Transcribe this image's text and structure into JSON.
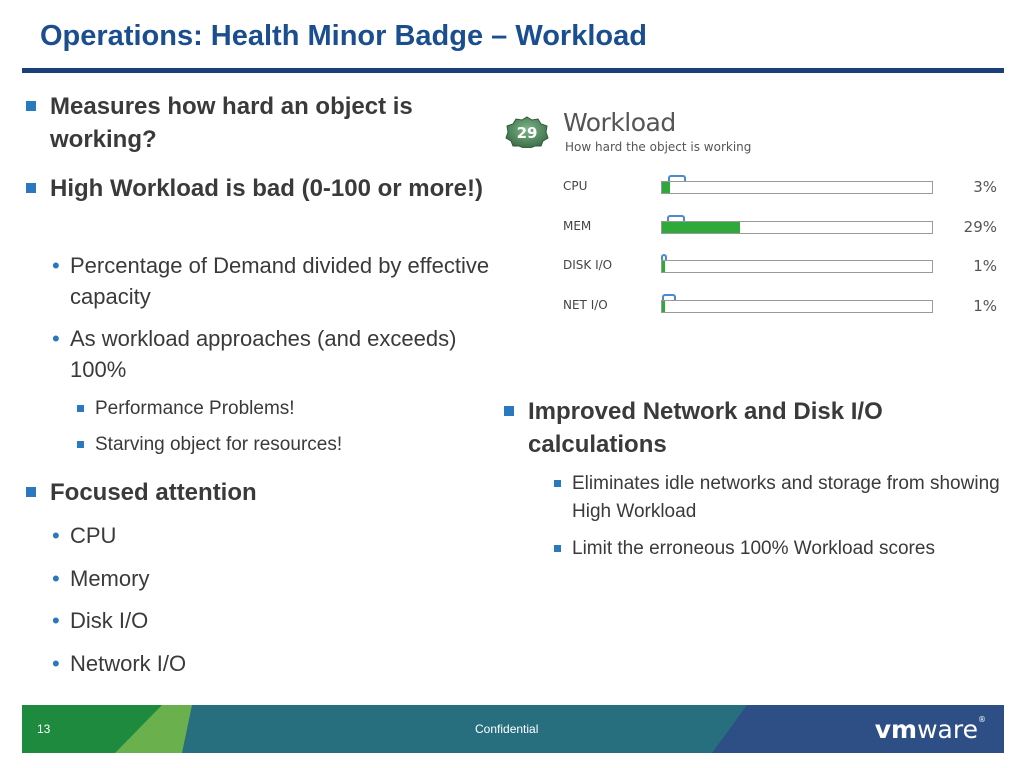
{
  "title": "Operations: Health Minor Badge – Workload",
  "left": {
    "b1": "Measures how hard an object is working?",
    "b2": "High Workload is bad (0-100 or more!)",
    "b2_sub1": "Percentage of Demand divided by effective capacity",
    "b2_sub2": "As workload approaches (and exceeds) 100%",
    "b2_sub2_a": "Performance Problems!",
    "b2_sub2_b": "Starving object for resources!",
    "b3": "Focused attention",
    "b3_items": [
      "CPU",
      "Memory",
      "Disk I/O",
      "Network I/O"
    ]
  },
  "widget": {
    "badge_value": "29",
    "title": "Workload",
    "subtitle": "How hard the object is working",
    "bar_color": "#2faa3a",
    "rows": [
      {
        "label": "CPU",
        "percent_text": "3%",
        "percent": 3
      },
      {
        "label": "MEM",
        "percent_text": "29%",
        "percent": 29
      },
      {
        "label": "DISK I/O",
        "percent_text": "1%",
        "percent": 1
      },
      {
        "label": "NET I/O",
        "percent_text": "1%",
        "percent": 1
      }
    ]
  },
  "right": {
    "b1": "Improved Network and Disk I/O calculations",
    "sub1": "Eliminates idle networks and storage from showing High Workload",
    "sub2": "Limit the erroneous 100% Workload scores"
  },
  "footer": {
    "page_number": "13",
    "confidential": "Confidential",
    "logo_bold": "vm",
    "logo_rest": "ware"
  }
}
